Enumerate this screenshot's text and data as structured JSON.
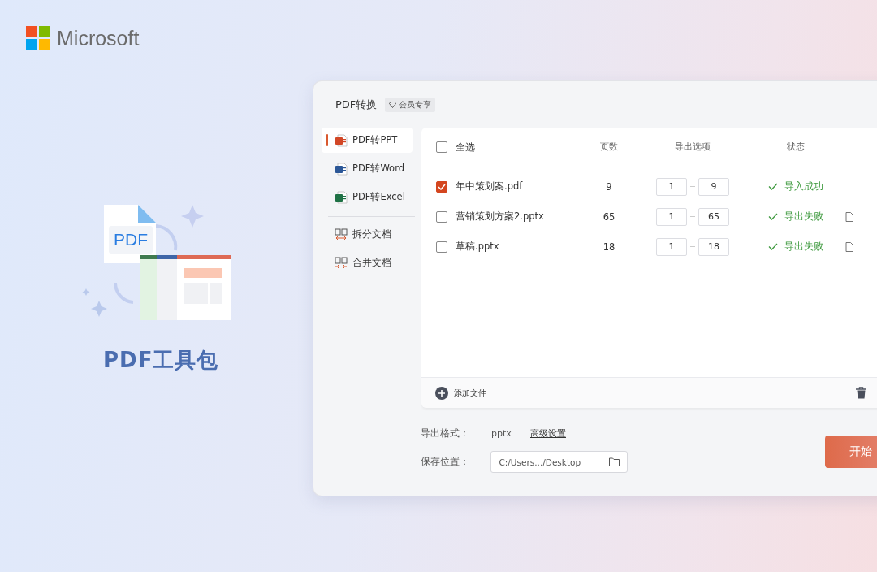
{
  "brand": {
    "name": "Microsoft"
  },
  "hero": {
    "illustration_label": "PDF",
    "title": "PDF工具包"
  },
  "window": {
    "title": "PDF转换",
    "badge": "会员专享"
  },
  "sidebar": {
    "items": [
      {
        "label": "PDF转PPT",
        "kind": "ppt",
        "selected": true
      },
      {
        "label": "PDF转Word",
        "kind": "word",
        "selected": false
      },
      {
        "label": "PDF转Excel",
        "kind": "excel",
        "selected": false
      },
      {
        "label": "拆分文档",
        "kind": "split",
        "selected": false
      },
      {
        "label": "合并文档",
        "kind": "merge",
        "selected": false
      }
    ]
  },
  "table": {
    "select_all": {
      "label": "全选",
      "checked": false
    },
    "columns": [
      "页数",
      "导出选项",
      "状态"
    ],
    "rows": [
      {
        "name": "年中策划案.pdf",
        "checked": true,
        "pages": "9",
        "from": "1",
        "to": "9",
        "status": "导入成功",
        "has_action": false
      },
      {
        "name": "营销策划方案2.pptx",
        "checked": false,
        "pages": "65",
        "from": "1",
        "to": "65",
        "status": "导出失败",
        "has_action": true
      },
      {
        "name": "草稿.pptx",
        "checked": false,
        "pages": "18",
        "from": "1",
        "to": "18",
        "status": "导出失败",
        "has_action": true
      }
    ],
    "add_button": "添加文件"
  },
  "settings": {
    "format_label": "导出格式：",
    "format_value": "pptx",
    "advanced_link": "高级设置",
    "location_label": "保存位置：",
    "location_value": "C:/Users.../Desktop"
  },
  "start_button": "开始"
}
